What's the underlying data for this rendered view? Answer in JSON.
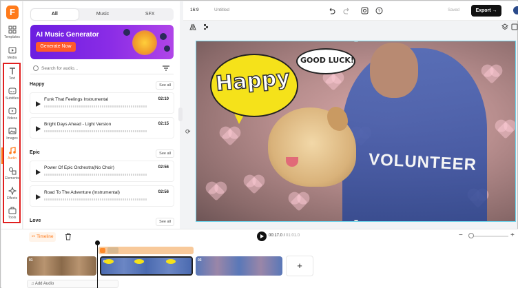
{
  "rail": {
    "logo": "F",
    "items": [
      {
        "label": "Templates",
        "icon": "templates-icon"
      },
      {
        "label": "Media",
        "icon": "media-icon"
      },
      {
        "label": "Text",
        "icon": "text-icon"
      },
      {
        "label": "Subtitles",
        "icon": "subtitles-icon"
      },
      {
        "label": "Videos",
        "icon": "videos-icon"
      },
      {
        "label": "Images",
        "icon": "images-icon"
      },
      {
        "label": "Audio",
        "icon": "audio-icon"
      },
      {
        "label": "Elements",
        "icon": "elements-icon"
      },
      {
        "label": "Effects",
        "icon": "effects-icon"
      },
      {
        "label": "Tools",
        "icon": "tools-icon"
      }
    ],
    "active_item": "Audio",
    "highlight_color": "#e01f1f"
  },
  "panel": {
    "tabs": [
      "All",
      "Music",
      "SFX"
    ],
    "active_tab": "All",
    "banner": {
      "title": "AI Music Generator",
      "button": "Generate Now"
    },
    "search_placeholder": "Search for audio...",
    "sections": [
      {
        "title": "Happy",
        "see_all": "See all",
        "tracks": [
          {
            "name": "Funk That Feelings Instrumental",
            "duration": "02:10"
          },
          {
            "name": "Bright Days Ahead - Light Version",
            "duration": "02:15"
          }
        ]
      },
      {
        "title": "Epic",
        "see_all": "See all",
        "tracks": [
          {
            "name": "Power Of Epic Orchestra(No Choir)",
            "duration": "02:56"
          },
          {
            "name": "Road To The Adventure (Instrumental)",
            "duration": "02:56"
          }
        ]
      },
      {
        "title": "Love",
        "see_all": "See all",
        "tracks": []
      }
    ]
  },
  "topbar": {
    "aspect": "16:9",
    "title": "Untitled",
    "saved": "Saved",
    "export": "Export",
    "accent": "#ff7a1a"
  },
  "canvas": {
    "sticker_happy": "Happy",
    "sticker_luck": "GOOD LUCK!",
    "shirt_text": "VOLUNTEER"
  },
  "timeline": {
    "label": "Timeline",
    "current_time": "00:17.0",
    "total_time": "01:01.0",
    "clips": [
      "01",
      "02",
      "03"
    ],
    "add_audio": "Add Audio",
    "add_clip": "+"
  }
}
